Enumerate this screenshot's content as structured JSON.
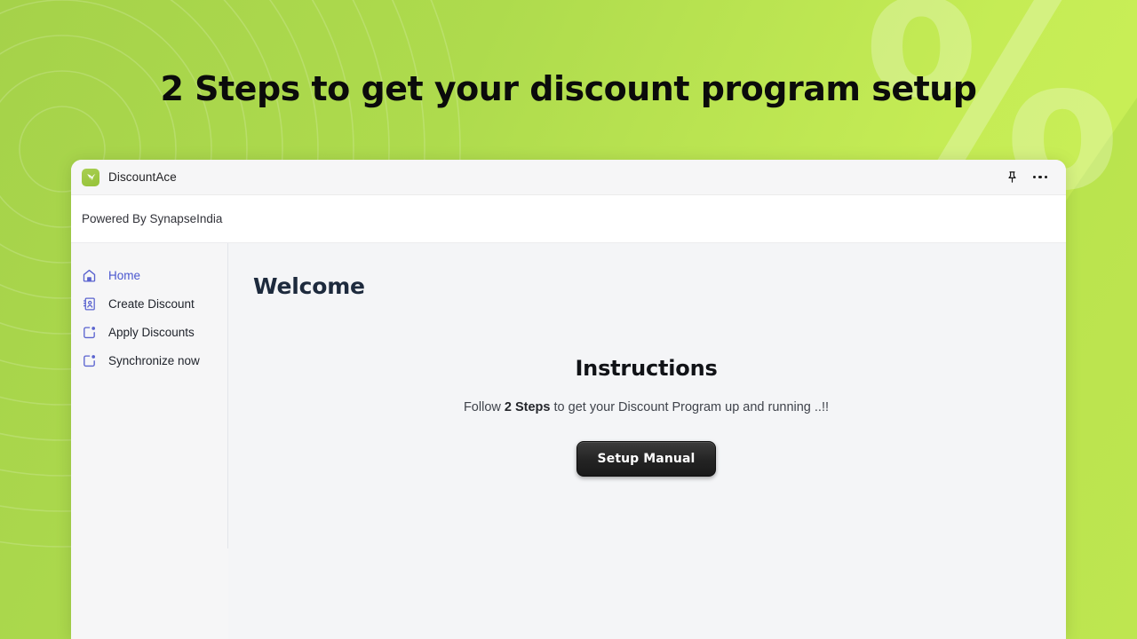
{
  "hero": {
    "headline": "2 Steps to get your discount program setup",
    "percent_glyph": "%",
    "accent_green_dark": "#a5d24a",
    "accent_green_light": "#cdf158"
  },
  "window": {
    "titlebar": {
      "app_name": "DiscountAce",
      "app_icon": "discountace-logo-icon",
      "pin_icon": "pin-icon",
      "more_icon": "more-options-icon"
    },
    "powered_by": "Powered By SynapseIndia"
  },
  "sidebar": {
    "items": [
      {
        "label": "Home",
        "icon": "home-icon",
        "active": true
      },
      {
        "label": "Create Discount",
        "icon": "contact-card-icon",
        "active": false
      },
      {
        "label": "Apply Discounts",
        "icon": "square-dot-icon",
        "active": false
      },
      {
        "label": "Synchronize now",
        "icon": "square-dot-icon",
        "active": false
      }
    ],
    "active_color": "#4a57cf"
  },
  "main": {
    "page_title": "Welcome",
    "instructions_heading": "Instructions",
    "instructions_prefix": "Follow ",
    "instructions_bold": "2 Steps",
    "instructions_suffix": " to get your Discount Program up and running ..!!",
    "setup_button_label": "Setup Manual"
  }
}
